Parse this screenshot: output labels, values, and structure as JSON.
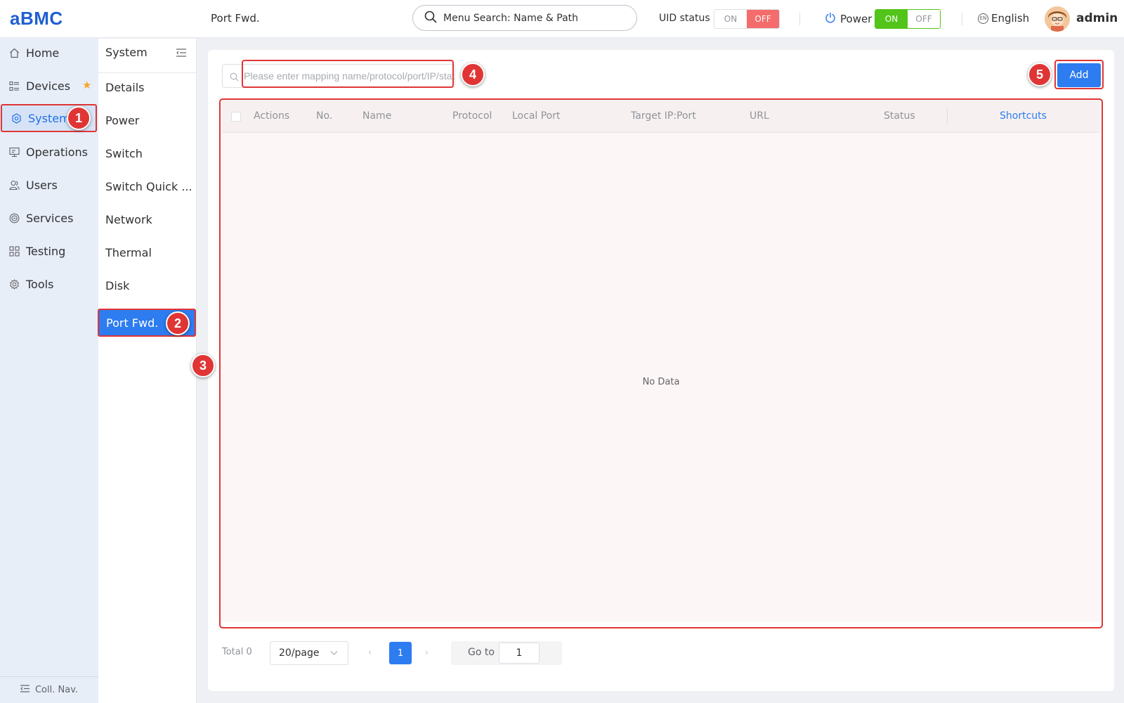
{
  "header": {
    "logo": "aBMC",
    "breadcrumb": "Port Fwd.",
    "menu_search_placeholder": "Menu Search: Name & Path",
    "uid_status_label": "UID status",
    "uid_on": "ON",
    "uid_off": "OFF",
    "power_label": "Power",
    "power_on": "ON",
    "power_off": "OFF",
    "language": "English",
    "language_icon_text": "EN",
    "username": "admin"
  },
  "nav1": {
    "items": [
      {
        "label": "Home",
        "icon": "home-icon"
      },
      {
        "label": "Devices",
        "icon": "devices-icon"
      },
      {
        "label": "System",
        "icon": "system-icon"
      },
      {
        "label": "Operations",
        "icon": "monitor-icon"
      },
      {
        "label": "Users",
        "icon": "users-icon"
      },
      {
        "label": "Services",
        "icon": "services-icon"
      },
      {
        "label": "Testing",
        "icon": "grid-icon"
      },
      {
        "label": "Tools",
        "icon": "gear-icon"
      }
    ],
    "active": "System",
    "collapse_label": "Coll. Nav."
  },
  "nav2": {
    "title": "System",
    "items": [
      "Details",
      "Power",
      "Switch",
      "Switch Quick ...",
      "Network",
      "Thermal",
      "Disk",
      "Port Fwd."
    ],
    "active": "Port Fwd."
  },
  "main": {
    "search_placeholder": "Please enter mapping name/protocol/port/IP/status",
    "add_label": "Add",
    "columns": [
      "Actions",
      "No.",
      "Name",
      "Protocol",
      "Local Port",
      "Target IP:Port",
      "URL",
      "Status"
    ],
    "shortcuts_label": "Shortcuts",
    "empty_text": "No Data",
    "pagination": {
      "total": "Total 0",
      "page_size": "20/page",
      "current_page": "1",
      "goto_label": "Go to",
      "goto_value": "1"
    }
  },
  "markers": [
    "1",
    "2",
    "3",
    "4",
    "5"
  ],
  "colors": {
    "accent": "#2d7cf0",
    "highlight": "#e03535",
    "power_on": "#52c41a",
    "uid_off": "#f56c6c"
  }
}
